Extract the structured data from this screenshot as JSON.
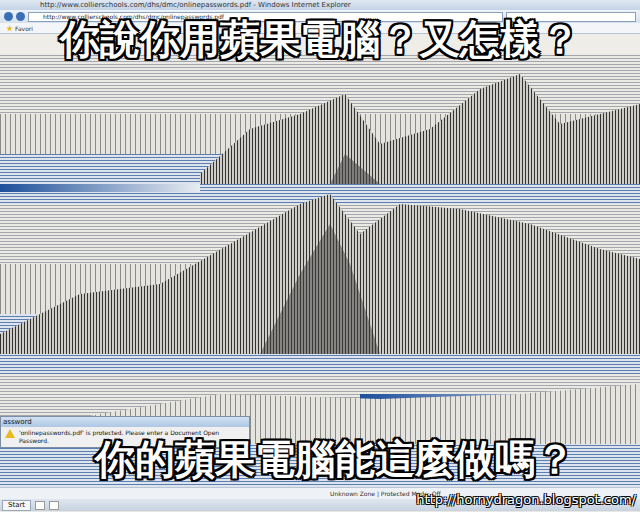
{
  "window": {
    "title": "http://www.collierschools.com/dhs/dmc/onlinepasswords.pdf - Windows Internet Explorer"
  },
  "address_bar": {
    "url": "http://www.collierschools.com/dhs/dmc/onlinepasswords.pdf"
  },
  "favorites": "Favori",
  "caption_top": "你說你用蘋果電腦？又怎樣？",
  "caption_bottom": "你的蘋果電腦能這麼做嗎？",
  "dialog": {
    "title": "assword",
    "message": "'onlinepasswords.pdf' is protected. Please enter a Document Open Password."
  },
  "status_bar": {
    "zone": "Unknown Zone | Protected Mode: Off"
  },
  "taskbar": {
    "start": "Start"
  },
  "watermark": "http://hornydragon.blogspot.com/"
}
